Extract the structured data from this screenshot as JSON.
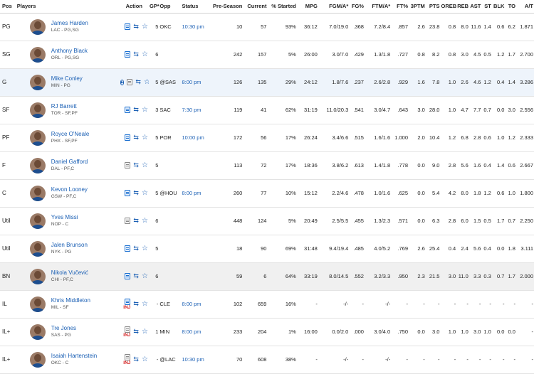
{
  "headers": [
    "Pos",
    "Players",
    "Action",
    "GP*",
    "Opp",
    "Status",
    "Pre-Season",
    "Current",
    "% Started",
    "MPG",
    "FGM/A*",
    "FG%",
    "FTM/A*",
    "FT%",
    "3PTM",
    "PTS",
    "OREB",
    "REB",
    "AST",
    "ST",
    "BLK",
    "TO",
    "A/T"
  ],
  "rows": [
    {
      "pos": "PG",
      "name": "James Harden",
      "team": "LAC - PG,SG",
      "gp": "5",
      "opp": "OKC",
      "status": "10:30 pm",
      "pre": "10",
      "cur": "57",
      "pct": "93%",
      "mpg": "36:12",
      "fgma": "7.0/19.0",
      "fgp": ".368",
      "ftma": "7.2/8.4",
      "ftp": ".857",
      "tpm": "2.6",
      "pts": "23.8",
      "oreb": "0.8",
      "reb": "8.0",
      "ast": "11.6",
      "st": "1.4",
      "blk": "0.6",
      "to": "6.2",
      "at": "1.871",
      "note": "blue"
    },
    {
      "pos": "SG",
      "name": "Anthony Black",
      "team": "ORL - PG,SG",
      "gp": "6",
      "opp": "",
      "status": "",
      "pre": "242",
      "cur": "157",
      "pct": "5%",
      "mpg": "26:00",
      "fgma": "3.0/7.0",
      "fgp": ".429",
      "ftma": "1.3/1.8",
      "ftp": ".727",
      "tpm": "0.8",
      "pts": "8.2",
      "oreb": "0.8",
      "reb": "3.0",
      "ast": "4.5",
      "st": "0.5",
      "blk": "1.2",
      "to": "1.7",
      "at": "2.700",
      "note": "blue"
    },
    {
      "pos": "G",
      "name": "Mike Conley",
      "team": "MIN - PG",
      "gp": "5",
      "opp": "@SAS",
      "status": "8:00 pm",
      "pre": "126",
      "cur": "135",
      "pct": "29%",
      "mpg": "24:12",
      "fgma": "1.8/7.6",
      "fgp": ".237",
      "ftma": "2.6/2.8",
      "ftp": ".929",
      "tpm": "1.6",
      "pts": "7.8",
      "oreb": "1.0",
      "reb": "2.6",
      "ast": "4.6",
      "st": "1.2",
      "blk": "0.4",
      "to": "1.4",
      "at": "3.286",
      "note": "gray",
      "play": true
    },
    {
      "pos": "SF",
      "name": "RJ Barrett",
      "team": "TOR - SF,PF",
      "gp": "3",
      "opp": "SAC",
      "status": "7:30 pm",
      "pre": "119",
      "cur": "41",
      "pct": "62%",
      "mpg": "31:19",
      "fgma": "11.0/20.3",
      "fgp": ".541",
      "ftma": "3.0/4.7",
      "ftp": ".643",
      "tpm": "3.0",
      "pts": "28.0",
      "oreb": "1.0",
      "reb": "4.7",
      "ast": "7.7",
      "st": "0.7",
      "blk": "0.0",
      "to": "3.0",
      "at": "2.556",
      "note": "blue"
    },
    {
      "pos": "PF",
      "name": "Royce O'Neale",
      "team": "PHX - SF,PF",
      "gp": "5",
      "opp": "POR",
      "status": "10:00 pm",
      "pre": "172",
      "cur": "56",
      "pct": "17%",
      "mpg": "26:24",
      "fgma": "3.4/6.6",
      "fgp": ".515",
      "ftma": "1.6/1.6",
      "ftp": "1.000",
      "tpm": "2.0",
      "pts": "10.4",
      "oreb": "1.2",
      "reb": "6.8",
      "ast": "2.8",
      "st": "0.6",
      "blk": "1.0",
      "to": "1.2",
      "at": "2.333",
      "note": "blue"
    },
    {
      "pos": "F",
      "name": "Daniel Gafford",
      "team": "DAL - PF,C",
      "gp": "5",
      "opp": "",
      "status": "",
      "pre": "113",
      "cur": "72",
      "pct": "17%",
      "mpg": "18:36",
      "fgma": "3.8/6.2",
      "fgp": ".613",
      "ftma": "1.4/1.8",
      "ftp": ".778",
      "tpm": "0.0",
      "pts": "9.0",
      "oreb": "2.8",
      "reb": "5.6",
      "ast": "1.6",
      "st": "0.4",
      "blk": "1.4",
      "to": "0.6",
      "at": "2.667",
      "note": "gray"
    },
    {
      "pos": "C",
      "name": "Kevon Looney",
      "team": "GSW - PF,C",
      "gp": "5",
      "opp": "@HOU",
      "status": "8:00 pm",
      "pre": "260",
      "cur": "77",
      "pct": "10%",
      "mpg": "15:12",
      "fgma": "2.2/4.6",
      "fgp": ".478",
      "ftma": "1.0/1.6",
      "ftp": ".625",
      "tpm": "0.0",
      "pts": "5.4",
      "oreb": "4.2",
      "reb": "8.0",
      "ast": "1.8",
      "st": "1.2",
      "blk": "0.6",
      "to": "1.0",
      "at": "1.800",
      "note": "blue"
    },
    {
      "pos": "Util",
      "name": "Yves Missi",
      "team": "NOP - C",
      "gp": "6",
      "opp": "",
      "status": "",
      "pre": "448",
      "cur": "124",
      "pct": "5%",
      "mpg": "20:49",
      "fgma": "2.5/5.5",
      "fgp": ".455",
      "ftma": "1.3/2.3",
      "ftp": ".571",
      "tpm": "0.0",
      "pts": "6.3",
      "oreb": "2.8",
      "reb": "6.0",
      "ast": "1.5",
      "st": "0.5",
      "blk": "1.7",
      "to": "0.7",
      "at": "2.250",
      "note": "gray"
    },
    {
      "pos": "Util",
      "name": "Jalen Brunson",
      "team": "NYK - PG",
      "gp": "5",
      "opp": "",
      "status": "",
      "pre": "18",
      "cur": "90",
      "pct": "69%",
      "mpg": "31:48",
      "fgma": "9.4/19.4",
      "fgp": ".485",
      "ftma": "4.0/5.2",
      "ftp": ".769",
      "tpm": "2.6",
      "pts": "25.4",
      "oreb": "0.4",
      "reb": "2.4",
      "ast": "5.6",
      "st": "0.4",
      "blk": "0.0",
      "to": "1.8",
      "at": "3.111",
      "note": "blue"
    },
    {
      "pos": "BN",
      "name": "Nikola Vučević",
      "team": "CHI - PF,C",
      "gp": "6",
      "opp": "",
      "status": "",
      "pre": "59",
      "cur": "6",
      "pct": "64%",
      "mpg": "33:19",
      "fgma": "8.0/14.5",
      "fgp": ".552",
      "ftma": "3.2/3.3",
      "ftp": ".950",
      "tpm": "2.3",
      "pts": "21.5",
      "oreb": "3.0",
      "reb": "11.0",
      "ast": "3.3",
      "st": "0.3",
      "blk": "0.7",
      "to": "1.7",
      "at": "2.000",
      "note": "blue",
      "bench": true
    },
    {
      "pos": "IL",
      "name": "Khris Middleton",
      "team": "MIL - SF",
      "gp": "-",
      "opp": "CLE",
      "status": "8:00 pm",
      "pre": "102",
      "cur": "659",
      "pct": "16%",
      "mpg": "-",
      "fgma": "-/-",
      "fgp": "-",
      "ftma": "-/-",
      "ftp": "-",
      "tpm": "-",
      "pts": "-",
      "oreb": "-",
      "reb": "-",
      "ast": "-",
      "st": "-",
      "blk": "-",
      "to": "-",
      "at": "-",
      "note": "blue",
      "inj": "INJ"
    },
    {
      "pos": "IL+",
      "name": "Tre Jones",
      "team": "SAS - PG",
      "gp": "1",
      "opp": "MIN",
      "status": "8:00 pm",
      "pre": "233",
      "cur": "204",
      "pct": "1%",
      "mpg": "16:00",
      "fgma": "0.0/2.0",
      "fgp": ".000",
      "ftma": "3.0/4.0",
      "ftp": ".750",
      "tpm": "0.0",
      "pts": "3.0",
      "oreb": "1.0",
      "reb": "1.0",
      "ast": "3.0",
      "st": "1.0",
      "blk": "0.0",
      "to": "0.0",
      "at": "-",
      "note": "gray",
      "inj": "INJ"
    },
    {
      "pos": "IL+",
      "name": "Isaiah Hartenstein",
      "team": "OKC - C",
      "gp": "-",
      "opp": "@LAC",
      "status": "10:30 pm",
      "pre": "70",
      "cur": "608",
      "pct": "38%",
      "mpg": "-",
      "fgma": "-/-",
      "fgp": "-",
      "ftma": "-/-",
      "ftp": "-",
      "tpm": "-",
      "pts": "-",
      "oreb": "-",
      "reb": "-",
      "ast": "-",
      "st": "-",
      "blk": "-",
      "to": "-",
      "at": "-",
      "note": "gray",
      "inj": "INJ"
    }
  ]
}
